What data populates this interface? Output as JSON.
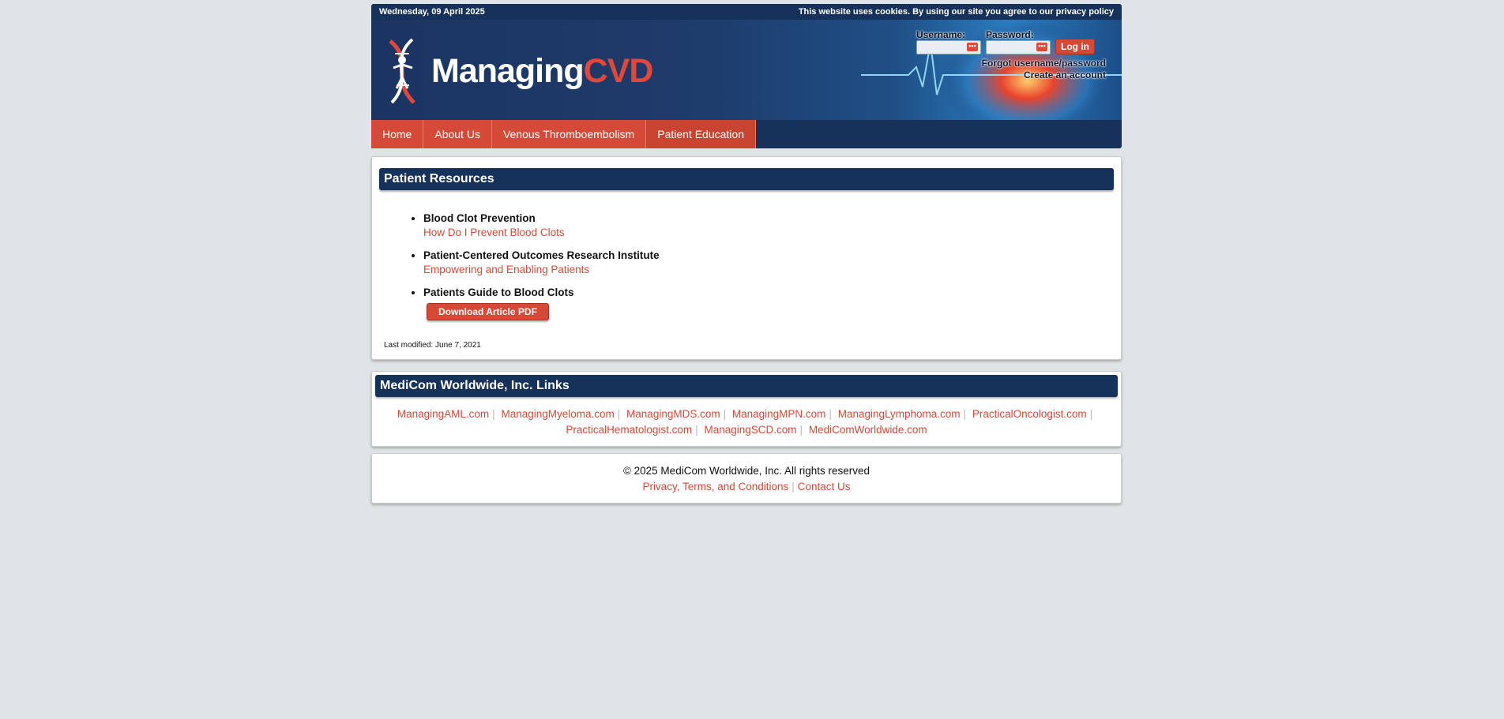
{
  "topbar": {
    "date": "Wednesday, 09 April 2025",
    "cookie_notice": "This website uses cookies. By using our site you agree to our privacy policy"
  },
  "logo": {
    "part1": "Managing",
    "part2": "CVD"
  },
  "login": {
    "username_label": "Username:",
    "password_label": "Password:",
    "button": "Log in",
    "forgot": "Forgot username/password",
    "create": "Create an account"
  },
  "nav": [
    {
      "label": "Home"
    },
    {
      "label": "About Us"
    },
    {
      "label": "Venous Thromboembolism"
    },
    {
      "label": "Patient Education"
    }
  ],
  "resources": {
    "title": "Patient Resources",
    "items": [
      {
        "title": "Blood Clot Prevention",
        "link": "How Do I Prevent Blood Clots"
      },
      {
        "title": "Patient-Centered Outcomes Research Institute",
        "link": "Empowering and Enabling Patients"
      },
      {
        "title": "Patients Guide to Blood Clots",
        "button": "Download Article PDF"
      }
    ],
    "last_modified": "Last modified: June 7, 2021"
  },
  "links": {
    "title": "MediCom Worldwide, Inc. Links",
    "sites": [
      "ManagingAML.com",
      "ManagingMyeloma.com",
      "ManagingMDS.com",
      "ManagingMPN.com",
      "ManagingLymphoma.com",
      "PracticalOncologist.com",
      "PracticalHematologist.com",
      "ManagingSCD.com",
      "MediComWorldwide.com"
    ],
    "separator": "|"
  },
  "footer": {
    "copyright": "© 2025 MediCom Worldwide, Inc. All rights reserved",
    "privacy": "Privacy, Terms, and Conditions",
    "contact": "Contact Us"
  },
  "colors": {
    "navy": "#16325a",
    "accent": "#d54a36",
    "background": "#dfe5e6"
  }
}
